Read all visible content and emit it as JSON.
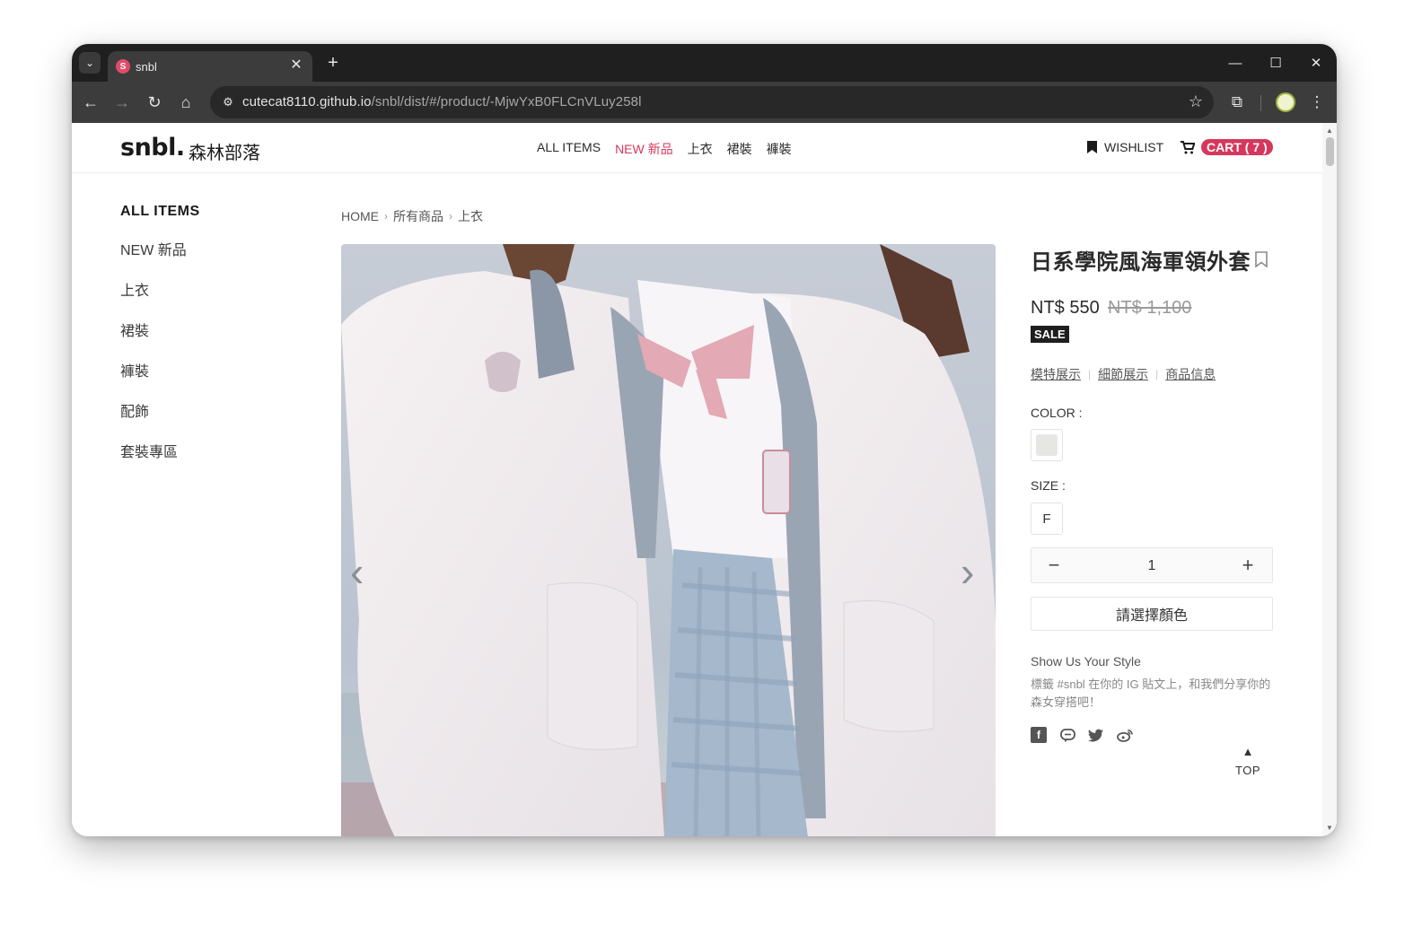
{
  "browser": {
    "tab_title": "snbl",
    "tab_favicon_letter": "S",
    "url_host": "cutecat8110.github.io",
    "url_path": "/snbl/dist/#/product/-MjwYxB0FLCnVLuy258l",
    "new_tab_symbol": "+",
    "tab_close_symbol": "✕"
  },
  "site": {
    "logo": "snbl.",
    "logo_sub": "森林部落",
    "nav": [
      "ALL ITEMS",
      "NEW 新品",
      "上衣",
      "裙裝",
      "褲裝"
    ],
    "wishlist_label": "WISHLIST",
    "cart_label": "CART ( 7 )",
    "accent_color": "#d6375c"
  },
  "sidebar": {
    "heading": "ALL ITEMS",
    "items": [
      "NEW 新品",
      "上衣",
      "裙裝",
      "褲裝",
      "配飾",
      "套裝專區"
    ]
  },
  "breadcrumb": [
    "HOME",
    "所有商品",
    "上衣"
  ],
  "product": {
    "title": "日系學院風海軍領外套",
    "price": "NT$ 550",
    "original_price": "NT$ 1,100",
    "badge": "SALE",
    "tabs": [
      "模特展示",
      "細節展示",
      "商品信息"
    ],
    "color_label": "COLOR :",
    "size_label": "SIZE :",
    "size_value": "F",
    "quantity": "1",
    "select_button": "請選擇顏色",
    "style_title": "Show Us Your Style",
    "style_desc": "標籤 #snbl 在你的 IG 貼文上，和我們分享你的森女穿搭吧！",
    "socials": [
      "facebook-icon",
      "line-icon",
      "twitter-icon",
      "weibo-icon"
    ]
  },
  "top_button": "TOP"
}
